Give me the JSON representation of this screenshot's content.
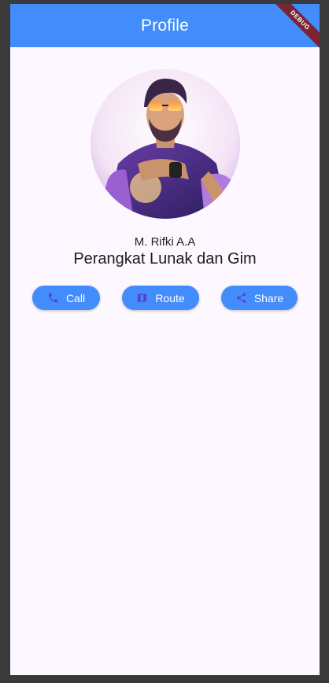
{
  "appbar": {
    "title": "Profile",
    "debug_label": "DEBUG"
  },
  "profile": {
    "name": "M. Rifki A.A",
    "subtitle": "Perangkat Lunak dan Gim"
  },
  "actions": {
    "call": {
      "label": "Call",
      "icon": "phone-icon"
    },
    "route": {
      "label": "Route",
      "icon": "map-icon"
    },
    "share": {
      "label": "Share",
      "icon": "share-icon"
    }
  },
  "colors": {
    "primary": "#428cfb",
    "icon_tint": "#5743c9",
    "background": "#fdf7ff",
    "debug": "#7a2434"
  }
}
